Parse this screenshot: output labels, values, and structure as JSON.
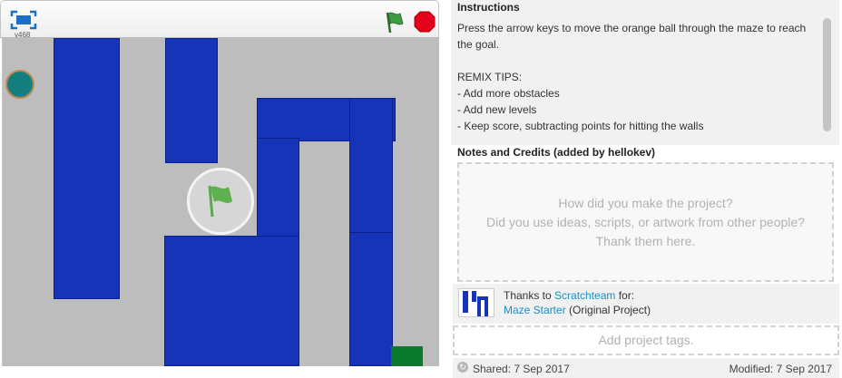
{
  "stage": {
    "version": "v468",
    "fullscreen_icon": "fullscreen-icon",
    "green_flag_icon": "green-flag-icon",
    "stop_icon": "stop-sign-icon",
    "play_overlay_icon": "green-flag-icon",
    "colors": {
      "background": "#bdbdbd",
      "walls": "#1634b8",
      "ball": "#157f80",
      "ball_outline": "#c08a56",
      "goal": "#0b7a2f",
      "flag": "#4caf50",
      "stop": "#e3001b"
    }
  },
  "info": {
    "instructions_title": "Instructions",
    "instructions_text": "Press the arrow keys to move the orange ball through the maze to reach the goal.\n\nREMIX TIPS:\n- Add more obstacles\n- Add new levels\n- Keep score, subtracting points for hitting the walls",
    "notes_title": "Notes and Credits (added by hellokev)",
    "notes_placeholder": "How did you make the project?\nDid you use ideas, scripts, or artwork from other people?\nThank them here.",
    "credits": {
      "thanks_prefix": "Thanks to ",
      "author": "Scratchteam",
      "thanks_suffix": " for:",
      "project": "Maze Starter",
      "project_suffix": " (Original Project)"
    },
    "tags_placeholder": "Add project tags.",
    "shared": "Shared: 7 Sep 2017",
    "modified": "Modified: 7 Sep 2017"
  }
}
